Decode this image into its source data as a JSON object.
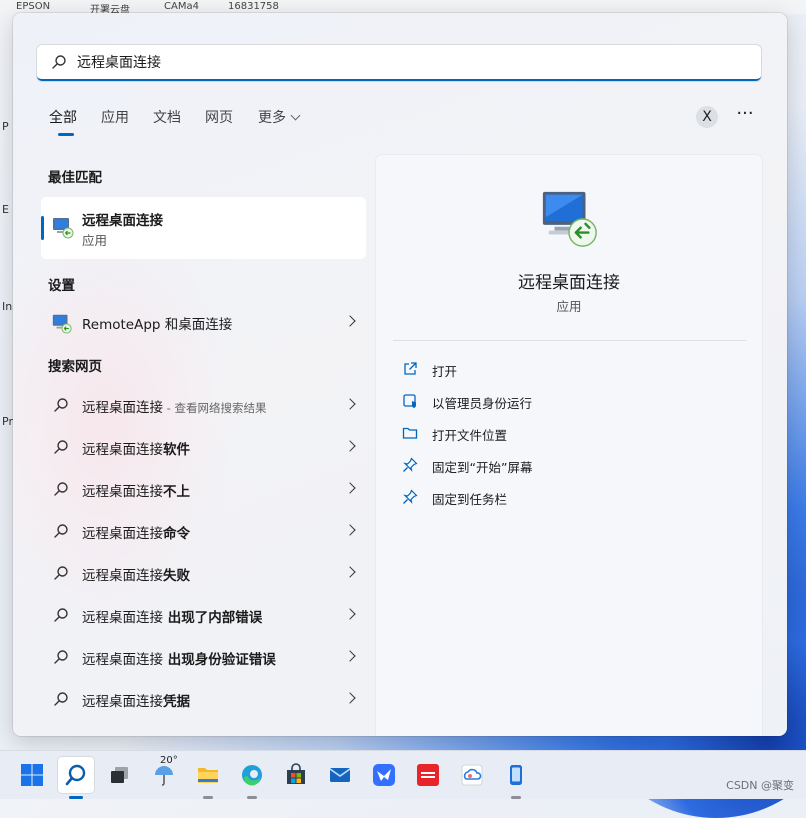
{
  "desktop": {
    "top_items": [
      "EPSON",
      "开署云盘",
      "CAMa4",
      "16831758"
    ],
    "left_labels": [
      "P",
      "E",
      "In",
      "Pr"
    ]
  },
  "search": {
    "query": "远程桌面连接"
  },
  "tabs": [
    {
      "label": "全部",
      "active": true
    },
    {
      "label": "应用",
      "active": false
    },
    {
      "label": "文档",
      "active": false
    },
    {
      "label": "网页",
      "active": false
    },
    {
      "label": "更多",
      "active": false
    }
  ],
  "header_buttons": {
    "close_label": "X",
    "more_label": "···"
  },
  "best_match": {
    "heading": "最佳匹配",
    "title": "远程桌面连接",
    "subtitle": "应用"
  },
  "settings": {
    "heading": "设置",
    "item": "RemoteApp 和桌面连接"
  },
  "web": {
    "heading": "搜索网页",
    "results": [
      {
        "prefix": "远程桌面连接",
        "bold": "",
        "sub": " - 查看网络搜索结果"
      },
      {
        "prefix": "远程桌面连接",
        "bold": "软件",
        "sub": ""
      },
      {
        "prefix": "远程桌面连接",
        "bold": "不上",
        "sub": ""
      },
      {
        "prefix": "远程桌面连接",
        "bold": "命令",
        "sub": ""
      },
      {
        "prefix": "远程桌面连接",
        "bold": "失败",
        "sub": ""
      },
      {
        "prefix": "远程桌面连接",
        "bold": " 出现了内部错误",
        "sub": ""
      },
      {
        "prefix": "远程桌面连接",
        "bold": " 出现身份验证错误",
        "sub": ""
      },
      {
        "prefix": "远程桌面连接",
        "bold": "凭据",
        "sub": ""
      }
    ]
  },
  "detail": {
    "name": "远程桌面连接",
    "kind": "应用",
    "actions": [
      {
        "label": "打开",
        "icon": "open-external-icon"
      },
      {
        "label": "以管理员身份运行",
        "icon": "run-as-admin-icon"
      },
      {
        "label": "打开文件位置",
        "icon": "folder-icon"
      },
      {
        "label": "固定到“开始”屏幕",
        "icon": "pin-icon"
      },
      {
        "label": "固定到任务栏",
        "icon": "pin-icon"
      }
    ]
  },
  "taskbar": {
    "weather_temp": "20°",
    "items": [
      "windows-start-icon",
      "search-icon",
      "task-view-icon",
      "weather-icon",
      "file-explorer-icon",
      "edge-icon",
      "store-icon",
      "mail-icon",
      "feishu-icon",
      "youdao-icon",
      "cloud-icon",
      "phone-link-icon"
    ]
  },
  "watermark": "CSDN @聚变",
  "colors": {
    "accent": "#0067c0",
    "panel_bg": "#f1f3f7"
  }
}
